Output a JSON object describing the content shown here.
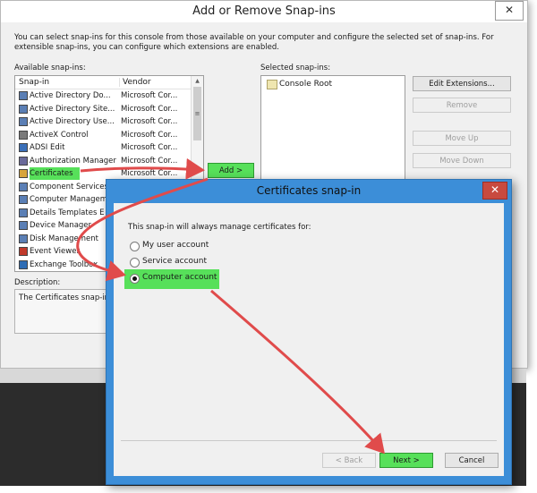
{
  "outer_dialog": {
    "title": "Add or Remove Snap-ins",
    "close_glyph": "✕",
    "intro": "You can select snap-ins for this console from those available on your computer and configure the selected set of snap-ins. For extensible snap-ins, you can configure which extensions are enabled.",
    "available_label": "Available snap-ins:",
    "columns": {
      "snapin": "Snap-in",
      "vendor": "Vendor"
    },
    "snapins": [
      {
        "name": "Active Directory Do...",
        "vendor": "Microsoft Cor...",
        "icon": "ad-domains-icon"
      },
      {
        "name": "Active Directory Site...",
        "vendor": "Microsoft Cor...",
        "icon": "ad-sites-icon"
      },
      {
        "name": "Active Directory Use...",
        "vendor": "Microsoft Cor...",
        "icon": "ad-users-icon"
      },
      {
        "name": "ActiveX Control",
        "vendor": "Microsoft Cor...",
        "icon": "activex-icon"
      },
      {
        "name": "ADSI Edit",
        "vendor": "Microsoft Cor...",
        "icon": "adsi-edit-icon"
      },
      {
        "name": "Authorization Manager",
        "vendor": "Microsoft Cor...",
        "icon": "authorization-icon"
      },
      {
        "name": "Certificates",
        "vendor": "Microsoft Cor...",
        "icon": "certificates-icon"
      },
      {
        "name": "Component Services",
        "vendor": "",
        "icon": "component-services-icon"
      },
      {
        "name": "Computer Managem",
        "vendor": "",
        "icon": "computer-management-icon"
      },
      {
        "name": "Details Templates E",
        "vendor": "",
        "icon": "details-templates-icon"
      },
      {
        "name": "Device Manager",
        "vendor": "",
        "icon": "device-manager-icon"
      },
      {
        "name": "Disk Management",
        "vendor": "",
        "icon": "disk-management-icon"
      },
      {
        "name": "Event Viewer",
        "vendor": "",
        "icon": "event-viewer-icon"
      },
      {
        "name": "Exchange Toolbox",
        "vendor": "",
        "icon": "exchange-toolbox-icon"
      }
    ],
    "add_button": "Add >",
    "selected_label": "Selected snap-ins:",
    "console_root": "Console Root",
    "edit_extensions": "Edit Extensions...",
    "remove": "Remove",
    "move_up": "Move Up",
    "move_down": "Move Down",
    "description_label": "Description:",
    "description_text": "The Certificates snap-in"
  },
  "inner_dialog": {
    "title": "Certificates snap-in",
    "close_glyph": "✕",
    "prompt": "This snap-in will always manage certificates for:",
    "options": [
      {
        "label": "My user account",
        "selected": false
      },
      {
        "label": "Service account",
        "selected": false
      },
      {
        "label": "Computer account",
        "selected": true
      }
    ],
    "back": "< Back",
    "next": "Next >",
    "cancel": "Cancel"
  },
  "colors": {
    "highlight_green": "#57e05a",
    "arrow_red": "#e04b4b",
    "dialog_blue": "#3c8ed8"
  }
}
